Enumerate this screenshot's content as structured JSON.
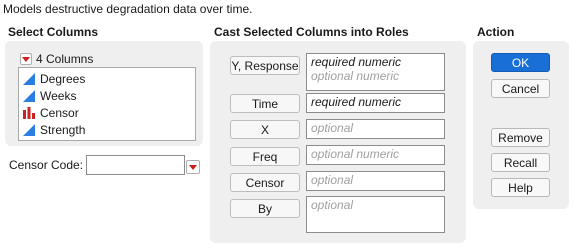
{
  "description": "Models destructive degradation data over time.",
  "select_columns": {
    "title": "Select Columns",
    "count_label": "4 Columns",
    "columns": [
      {
        "name": "Degrees",
        "icon": "continuous-icon"
      },
      {
        "name": "Weeks",
        "icon": "continuous-icon"
      },
      {
        "name": "Censor",
        "icon": "nominal-bar-icon"
      },
      {
        "name": "Strength",
        "icon": "continuous-icon"
      }
    ]
  },
  "censor_code": {
    "label": "Censor Code:",
    "value": ""
  },
  "cast": {
    "title": "Cast Selected Columns into Roles",
    "roles": [
      {
        "button": "Y, Response",
        "lines": [
          "required numeric",
          "optional numeric"
        ],
        "required": [
          true,
          false
        ]
      },
      {
        "button": "Time",
        "lines": [
          "required numeric"
        ],
        "required": [
          true
        ]
      },
      {
        "button": "X",
        "lines": [
          "optional"
        ],
        "required": [
          false
        ]
      },
      {
        "button": "Freq",
        "lines": [
          "optional numeric"
        ],
        "required": [
          false
        ]
      },
      {
        "button": "Censor",
        "lines": [
          "optional"
        ],
        "required": [
          false
        ]
      },
      {
        "button": "By",
        "lines": [
          "optional"
        ],
        "required": [
          false
        ]
      }
    ]
  },
  "action": {
    "title": "Action",
    "ok": "OK",
    "cancel": "Cancel",
    "remove": "Remove",
    "recall": "Recall",
    "help": "Help"
  },
  "colors": {
    "accent": "#1a6fd6",
    "continuous_icon": "#2a7de1",
    "nominal_icon": "#cc2222",
    "dropdown_triangle": "#cc1f1f"
  }
}
